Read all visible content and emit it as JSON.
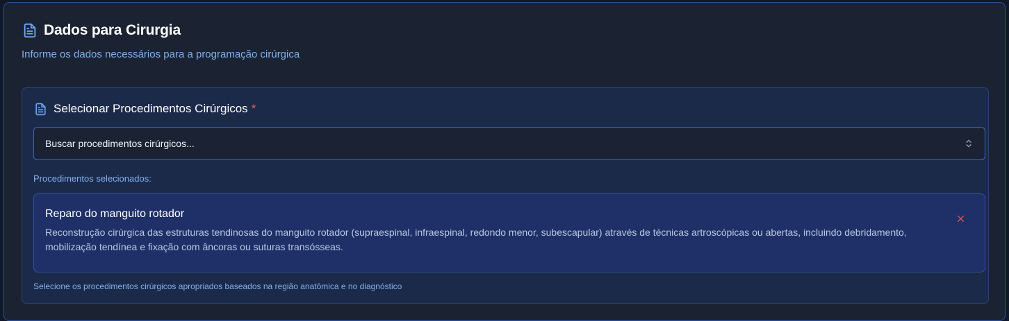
{
  "header": {
    "title": "Dados para Cirurgia",
    "subtitle": "Informe os dados necessários para a programação cirúrgica",
    "icon": "document-icon"
  },
  "procedures": {
    "title": "Selecionar Procedimentos Cirúrgicos",
    "required_marker": "*",
    "search": {
      "placeholder": "Buscar procedimentos cirúrgicos...",
      "icon": "chevron-up-down-icon"
    },
    "selected_label": "Procedimentos selecionados:",
    "selected": [
      {
        "name": "Reparo do manguito rotador",
        "description": "Reconstrução cirúrgica das estruturas tendinosas do manguito rotador (supraespinal, infraespinal, redondo menor, subescapular) através de técnicas artroscópicas ou abertas, incluindo debridamento, mobilização tendínea e fixação com âncoras ou suturas transósseas.",
        "remove_icon": "close-icon"
      }
    ],
    "hint": "Selecione os procedimentos cirúrgicos apropriados baseados na região anatômica e no diagnóstico"
  },
  "colors": {
    "accent": "#3566d6",
    "icon_blue": "#6ea8f5",
    "required": "#f05555",
    "remove": "#f05555"
  }
}
